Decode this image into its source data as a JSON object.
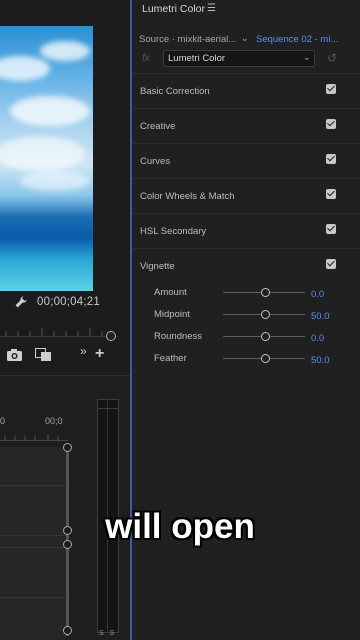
{
  "program_monitor": {
    "timecode": "00;00;04;21"
  },
  "timeline": {
    "ruler_ticks": [
      "0",
      "00;0"
    ],
    "audio_meter_footer": "S S"
  },
  "lumetri": {
    "title": "Lumetri Color",
    "menu_icon": "hamburger-icon",
    "source_label": "Source · mixkit-aerial...",
    "sequence_label": "Sequence 02 - mi...",
    "fx_label": "fx",
    "effect_select": "Lumetri Color",
    "sections": [
      {
        "label": "Basic Correction",
        "checked": true
      },
      {
        "label": "Creative",
        "checked": true
      },
      {
        "label": "Curves",
        "checked": true
      },
      {
        "label": "Color Wheels & Match",
        "checked": true
      },
      {
        "label": "HSL Secondary",
        "checked": true
      },
      {
        "label": "Vignette",
        "checked": true
      }
    ],
    "vignette_params": [
      {
        "label": "Amount",
        "value": "0.0"
      },
      {
        "label": "Midpoint",
        "value": "50.0"
      },
      {
        "label": "Roundness",
        "value": "0.0"
      },
      {
        "label": "Feather",
        "value": "50.0"
      }
    ]
  },
  "caption": "will open",
  "colors": {
    "accent_blue": "#5d8ff0",
    "panel_bg": "#202020",
    "panel_divider": "#3d5aa8"
  }
}
